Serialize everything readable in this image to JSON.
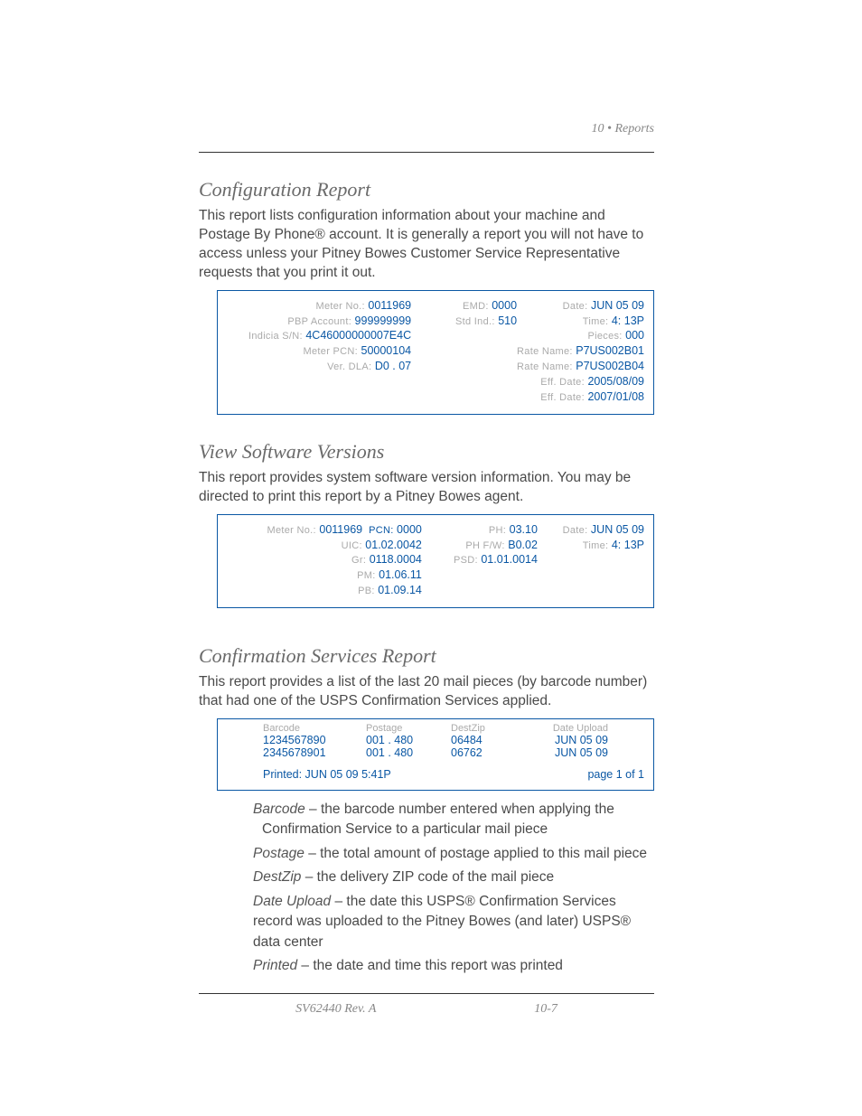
{
  "header": {
    "chapter": "10 • Reports",
    "page_top": ""
  },
  "section1": {
    "title": "Configuration Report",
    "intro": "This report lists configuration information about your machine and Postage By Phone® account. It is generally a report you will not have to access unless your Pitney Bowes Customer Service Representative requests that you print it out.",
    "labels": {
      "meter": "Meter No.:",
      "pbp": "PBP Account:",
      "indicia": "Indicia S/N:",
      "meterpcn": "Meter PCN:",
      "ver": "Ver. DLA:",
      "emd": "EMD:",
      "std_ind": "Std Ind.:",
      "date": "Date:",
      "time": "Time:",
      "pieces": "Pieces:",
      "rate1": "Rate Name:",
      "rate2": "Rate Name:",
      "eff1": "Eff. Date:",
      "eff2": "Eff. Date:"
    },
    "vals": {
      "meter": "0011969",
      "pbp": "999999999",
      "indicia": "4C46000000007E4C",
      "meterpcn": "50000104",
      "ver": "D0 . 07",
      "emd": "0000",
      "std_ind": "510",
      "date": "JUN 05 09",
      "time": "4: 13P",
      "pieces": "000",
      "rate1": "P7US002B01",
      "rate2": "P7US002B04",
      "eff1": "2005/08/09",
      "eff2": "2007/01/08"
    }
  },
  "section2": {
    "title": "View Software Versions",
    "intro": "This report provides system software version information. You may be directed to print this report by a Pitney Bowes agent.",
    "labels": {
      "meter": "Meter No.:",
      "pcn": "PCN:",
      "uic": "UIC:",
      "gr": "Gr:",
      "pm": "PM:",
      "pb": "PB:",
      "ph": "PH:",
      "phfw": "PH F/W:",
      "psd": "PSD:",
      "date": "Date:",
      "time": "Time:"
    },
    "vals": {
      "meter": "0011969",
      "pcn": "0000",
      "uic": "01.02.0042",
      "gr": "0118.0004",
      "pm": "01.06.11",
      "pb": "01.09.14",
      "ph": "03.10",
      "phfw": "B0.02",
      "psd": "01.01.0014",
      "date": "JUN 05 09",
      "time": "4: 13P"
    }
  },
  "section3": {
    "title": "Confirmation Services Report",
    "intro": "This report provides a list of the last 20 mail pieces (by barcode number) that had one of the USPS Confirmation Services applied.",
    "columns": {
      "barcode": "Barcode",
      "postage": "Postage",
      "dest_zip": "DestZip",
      "date_upload": "Date Upload"
    },
    "rows": [
      {
        "barcode": "1234567890",
        "postage": "001 . 480",
        "dest": "06484",
        "date": "JUN 05 09"
      },
      {
        "barcode": "2345678901",
        "postage": "001 . 480",
        "dest": "06762",
        "date": "JUN 05 09"
      }
    ],
    "printed_label": "Printed:  JUN 05 09  5:41P",
    "page_label": "page 1 of 1"
  },
  "defs": {
    "barcode": " – the barcode number entered when applying the Confirmation Service to a particular mail piece",
    "postage": " – the total amount of postage applied to this mail piece",
    "destzip": " – the delivery ZIP code of the mail piece",
    "dateupload": " – the date this USPS® Confirmation Services record was uploaded to the Pitney Bowes (and later) USPS® data center",
    "printed": " – the date and time this report was printed",
    "terms": {
      "barcode": "Barcode",
      "postage": "Postage",
      "destzip": "DestZip",
      "dateupload": "Date Upload",
      "printed": "Printed"
    }
  },
  "footer": {
    "text": "10-7",
    "model": "SV62440 Rev. A"
  }
}
